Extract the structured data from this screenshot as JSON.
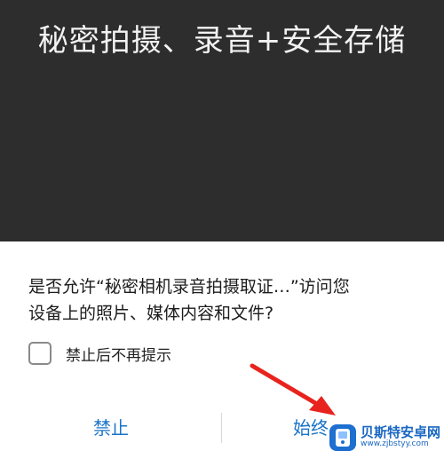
{
  "banner": {
    "title": "秘密拍摄、录音+安全存储"
  },
  "permission_dialog": {
    "message_line1": "是否允许“秘密相机录音拍摄取证…”访问您",
    "message_line2": "设备上的照片、媒体内容和文件?",
    "checkbox": {
      "label": "禁止后不再提示",
      "checked": false
    },
    "buttons": {
      "deny": "禁止",
      "allow": "始终"
    },
    "accent_color": "#1a73c7"
  },
  "annotation": {
    "arrow_color": "#e8231d",
    "arrow-icon": "red-arrow-icon"
  },
  "watermark": {
    "name": "贝斯特安卓网",
    "url": "www.zjbstyy.com",
    "logo-icon": "bestandroid-logo-icon"
  }
}
